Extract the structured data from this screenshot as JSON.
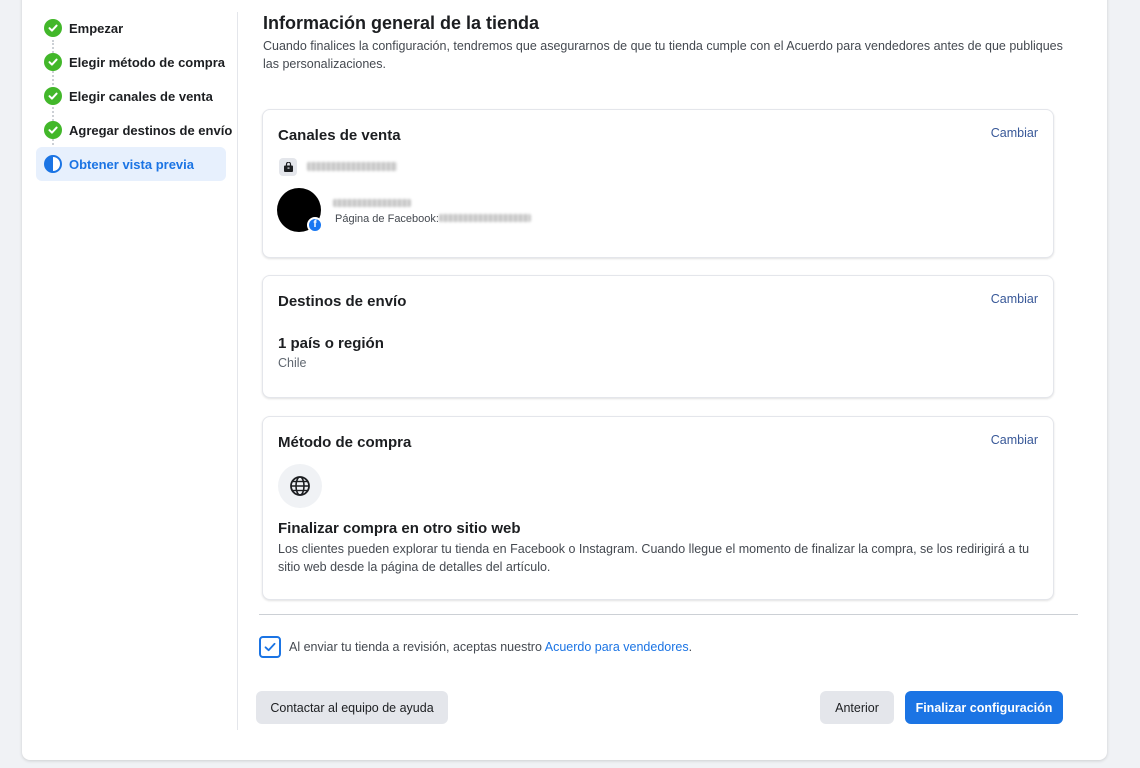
{
  "sidebar": {
    "steps": [
      {
        "label": "Empezar",
        "state": "done"
      },
      {
        "label": "Elegir método de compra",
        "state": "done"
      },
      {
        "label": "Elegir canales de venta",
        "state": "done"
      },
      {
        "label": "Agregar destinos de envío",
        "state": "done"
      },
      {
        "label": "Obtener vista previa",
        "state": "current"
      }
    ]
  },
  "main": {
    "title": "Información general de la tienda",
    "subtitle": "Cuando finalices la configuración, tendremos que asegurarnos de que tu tienda cumple con el Acuerdo para vendedores antes de que publiques las personalizaciones."
  },
  "cards": {
    "sales_channels": {
      "title": "Canales de venta",
      "change_label": "Cambiar",
      "facebook_page_label": "Página de Facebook:"
    },
    "shipping": {
      "title": "Destinos de envío",
      "change_label": "Cambiar",
      "region_count": "1 país o región",
      "region_list": "Chile"
    },
    "checkout": {
      "title": "Método de compra",
      "change_label": "Cambiar",
      "method_title": "Finalizar compra en otro sitio web",
      "method_desc": "Los clientes pueden explorar tu tienda en Facebook o Instagram. Cuando llegue el momento de finalizar la compra, se los redirigirá a tu sitio web desde la página de detalles del artículo."
    }
  },
  "agreement": {
    "checked": true,
    "text": "Al enviar tu tienda a revisión, aceptas nuestro",
    "link": "Acuerdo para vendedores",
    "suffix": "."
  },
  "footer": {
    "help_button": "Contactar al equipo de ayuda",
    "back_button": "Anterior",
    "finish_button": "Finalizar configuración"
  },
  "colors": {
    "accent": "#1b74e4",
    "success": "#42b72a",
    "link": "#385898"
  },
  "icons": {
    "done_step": "check-circle-icon",
    "current_step": "half-circle-icon",
    "shop": "shop-bag-icon",
    "facebook_badge": "facebook-icon",
    "globe": "globe-icon",
    "checkbox": "checkmark-icon"
  }
}
